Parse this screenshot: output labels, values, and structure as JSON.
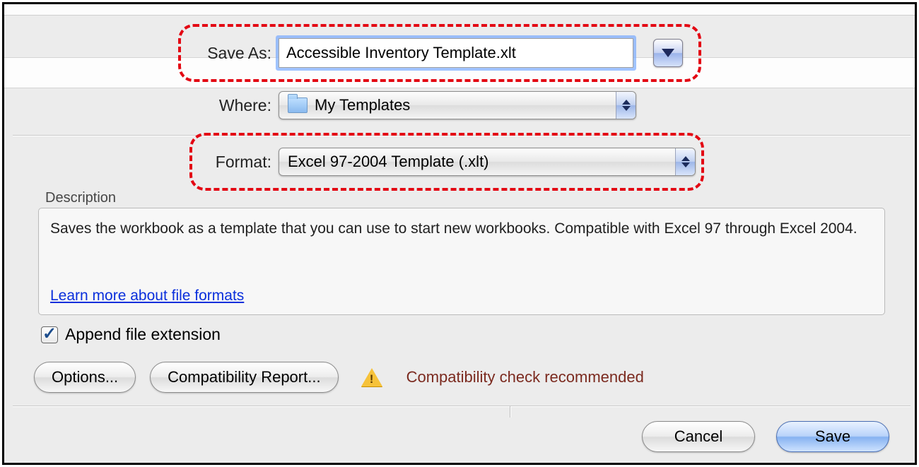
{
  "labels": {
    "save_as": "Save As:",
    "where": "Where:",
    "format": "Format:",
    "description": "Description",
    "append": "Append file extension",
    "learn_more": "Learn more about file formats",
    "compat_warning": "Compatibility check recommended"
  },
  "values": {
    "filename": "Accessible Inventory Template.xlt",
    "where": "My Templates",
    "format": "Excel 97-2004 Template (.xlt)"
  },
  "description_text": "Saves the workbook as a template that you can use to start new workbooks. Compatible with Excel 97 through Excel 2004.",
  "buttons": {
    "options": "Options...",
    "compat_report": "Compatibility Report...",
    "cancel": "Cancel",
    "save": "Save"
  },
  "checkbox": {
    "append_checked": true
  }
}
